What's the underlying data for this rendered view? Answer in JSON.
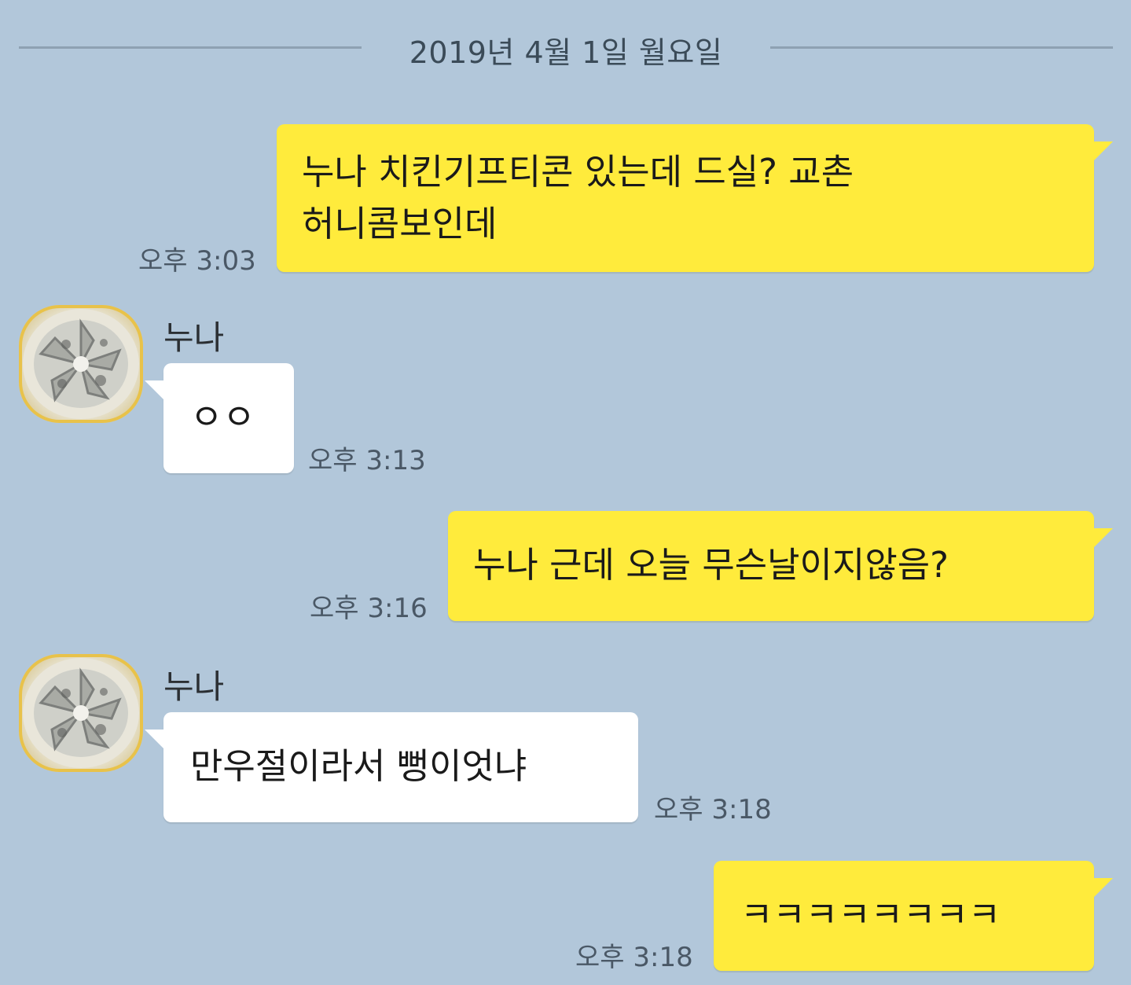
{
  "date_divider": {
    "label": "2019년 4월 1일 월요일"
  },
  "messages": [
    {
      "from": "me",
      "lines": [
        "누나 치킨기프티콘 있는데 드실? 교촌",
        "허니콤보인데"
      ],
      "time": "오후 3:03"
    },
    {
      "from": "other",
      "sender": "누나",
      "lines": [
        "ㅇㅇ"
      ],
      "time": "오후 3:13"
    },
    {
      "from": "me",
      "lines": [
        "누나 근데 오늘 무슨날이지않음?"
      ],
      "time": "오후 3:16"
    },
    {
      "from": "other",
      "sender": "누나",
      "lines": [
        "만우절이라서 뻥이엇냐"
      ],
      "time": "오후 3:18"
    },
    {
      "from": "me",
      "lines": [
        "ㅋㅋㅋㅋㅋㅋㅋㅋ"
      ],
      "time": "오후 3:18"
    }
  ],
  "colors": {
    "background": "#b2c7da",
    "my_bubble": "#ffeb3c",
    "other_bubble": "#ffffff"
  },
  "icons": {
    "avatar": "lemon-slice-avatar"
  }
}
